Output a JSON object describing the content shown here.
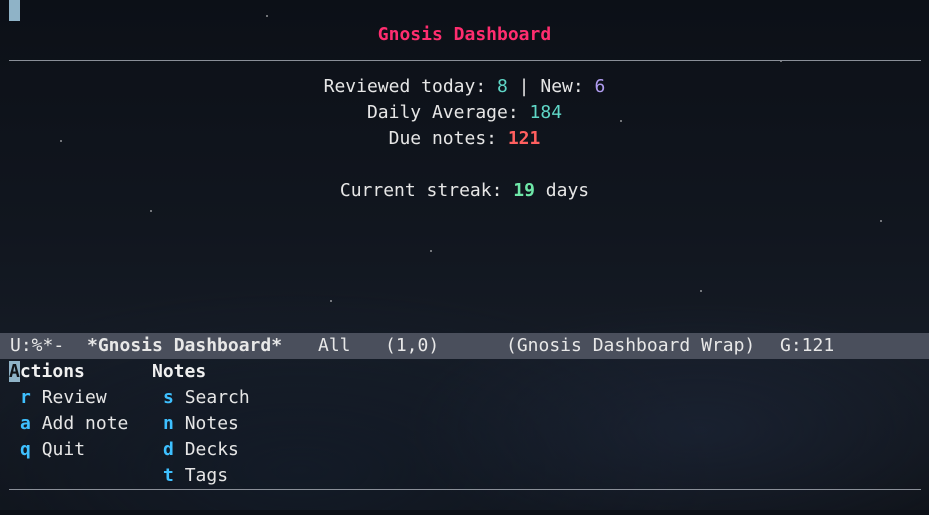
{
  "dashboard": {
    "title": "Gnosis Dashboard",
    "reviewed_label": "Reviewed today: ",
    "reviewed_value": "8",
    "separator": " | ",
    "new_label": "New: ",
    "new_value": "6",
    "daily_average_label": "Daily Average: ",
    "daily_average_value": "184",
    "due_label": "Due notes: ",
    "due_value": "121",
    "streak_label": "Current streak: ",
    "streak_value": "19",
    "streak_unit": " days"
  },
  "modeline": {
    "status": "U:%*-",
    "buffer": "*Gnosis Dashboard*",
    "position": "All",
    "cursor": "(1,0)",
    "mode": "(Gnosis Dashboard Wrap)",
    "due_count": "G:121"
  },
  "menu": {
    "actions_heading_first": "A",
    "actions_heading_rest": "ctions",
    "actions": [
      {
        "key": "r",
        "label": "Review"
      },
      {
        "key": "a",
        "label": "Add note"
      },
      {
        "key": "q",
        "label": "Quit"
      }
    ],
    "notes_heading": "Notes",
    "notes": [
      {
        "key": "s",
        "label": "Search"
      },
      {
        "key": "n",
        "label": "Notes"
      },
      {
        "key": "d",
        "label": "Decks"
      },
      {
        "key": "t",
        "label": "Tags"
      }
    ]
  },
  "colors": {
    "title": "#ff2d6f",
    "value_teal": "#5fd7c7",
    "value_purple": "#b09cf0",
    "value_red": "#ff5f5f",
    "value_green": "#6ee7a8",
    "key": "#3ec0ff",
    "modeline_bg": "#4a4f5c",
    "cursor": "#8fb3c7"
  }
}
